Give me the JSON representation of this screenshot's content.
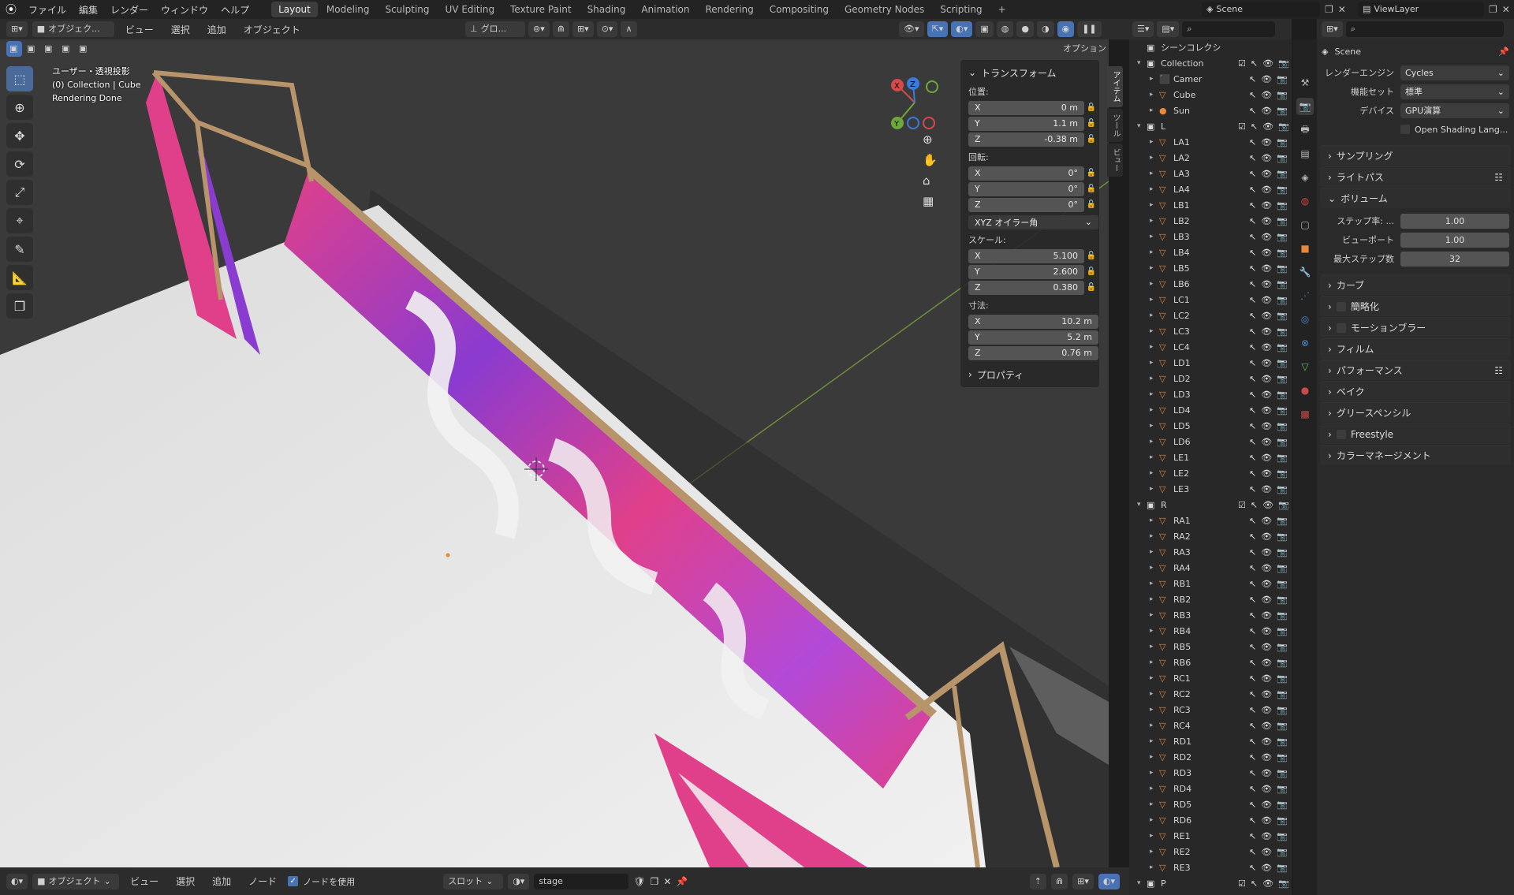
{
  "topbar": {
    "menus": [
      "ファイル",
      "編集",
      "レンダー",
      "ウィンドウ",
      "ヘルプ"
    ],
    "workspaces": [
      "Layout",
      "Modeling",
      "Sculpting",
      "UV Editing",
      "Texture Paint",
      "Shading",
      "Animation",
      "Rendering",
      "Compositing",
      "Geometry Nodes",
      "Scripting"
    ],
    "active_workspace": "Layout",
    "scene": "Scene",
    "viewlayer": "ViewLayer"
  },
  "viewport_header": {
    "mode": "オブジェク...",
    "menus": [
      "ビュー",
      "選択",
      "追加",
      "オブジェクト"
    ],
    "transform_orientation": "グロ...",
    "options": "オプション"
  },
  "overlay": {
    "line1": "ユーザー・透視投影",
    "line2": "(0) Collection | Cube",
    "line3": "Rendering Done"
  },
  "npanel": {
    "title": "トランスフォーム",
    "location_label": "位置:",
    "location": [
      {
        "axis": "X",
        "value": "0 m"
      },
      {
        "axis": "Y",
        "value": "1.1 m"
      },
      {
        "axis": "Z",
        "value": "-0.38 m"
      }
    ],
    "rotation_label": "回転:",
    "rotation": [
      {
        "axis": "X",
        "value": "0°"
      },
      {
        "axis": "Y",
        "value": "0°"
      },
      {
        "axis": "Z",
        "value": "0°"
      }
    ],
    "rotation_mode": "XYZ オイラー角",
    "scale_label": "スケール:",
    "scale": [
      {
        "axis": "X",
        "value": "5.100"
      },
      {
        "axis": "Y",
        "value": "2.600"
      },
      {
        "axis": "Z",
        "value": "0.380"
      }
    ],
    "dimensions_label": "寸法:",
    "dimensions": [
      {
        "axis": "X",
        "value": "10.2 m"
      },
      {
        "axis": "Y",
        "value": "5.2 m"
      },
      {
        "axis": "Z",
        "value": "0.76 m"
      }
    ],
    "properties": "プロパティ",
    "side_tabs": [
      "アイテム",
      "ツール",
      "ビュー"
    ]
  },
  "outliner": {
    "title": "シーンコレクシ",
    "rows": [
      {
        "name": "Collection",
        "level": 0,
        "type": "collection"
      },
      {
        "name": "Camer",
        "level": 1,
        "type": "camera"
      },
      {
        "name": "Cube",
        "level": 1,
        "type": "mesh"
      },
      {
        "name": "Sun",
        "level": 1,
        "type": "light"
      },
      {
        "name": "L",
        "level": 0,
        "type": "collection"
      },
      {
        "name": "LA1",
        "level": 1,
        "type": "mesh"
      },
      {
        "name": "LA2",
        "level": 1,
        "type": "mesh"
      },
      {
        "name": "LA3",
        "level": 1,
        "type": "mesh"
      },
      {
        "name": "LA4",
        "level": 1,
        "type": "mesh"
      },
      {
        "name": "LB1",
        "level": 1,
        "type": "mesh"
      },
      {
        "name": "LB2",
        "level": 1,
        "type": "mesh"
      },
      {
        "name": "LB3",
        "level": 1,
        "type": "mesh"
      },
      {
        "name": "LB4",
        "level": 1,
        "type": "mesh"
      },
      {
        "name": "LB5",
        "level": 1,
        "type": "mesh"
      },
      {
        "name": "LB6",
        "level": 1,
        "type": "mesh"
      },
      {
        "name": "LC1",
        "level": 1,
        "type": "mesh"
      },
      {
        "name": "LC2",
        "level": 1,
        "type": "mesh"
      },
      {
        "name": "LC3",
        "level": 1,
        "type": "mesh"
      },
      {
        "name": "LC4",
        "level": 1,
        "type": "mesh"
      },
      {
        "name": "LD1",
        "level": 1,
        "type": "mesh"
      },
      {
        "name": "LD2",
        "level": 1,
        "type": "mesh"
      },
      {
        "name": "LD3",
        "level": 1,
        "type": "mesh"
      },
      {
        "name": "LD4",
        "level": 1,
        "type": "mesh"
      },
      {
        "name": "LD5",
        "level": 1,
        "type": "mesh"
      },
      {
        "name": "LD6",
        "level": 1,
        "type": "mesh"
      },
      {
        "name": "LE1",
        "level": 1,
        "type": "mesh"
      },
      {
        "name": "LE2",
        "level": 1,
        "type": "mesh"
      },
      {
        "name": "LE3",
        "level": 1,
        "type": "mesh"
      },
      {
        "name": "R",
        "level": 0,
        "type": "collection"
      },
      {
        "name": "RA1",
        "level": 1,
        "type": "mesh"
      },
      {
        "name": "RA2",
        "level": 1,
        "type": "mesh"
      },
      {
        "name": "RA3",
        "level": 1,
        "type": "mesh"
      },
      {
        "name": "RA4",
        "level": 1,
        "type": "mesh"
      },
      {
        "name": "RB1",
        "level": 1,
        "type": "mesh"
      },
      {
        "name": "RB2",
        "level": 1,
        "type": "mesh"
      },
      {
        "name": "RB3",
        "level": 1,
        "type": "mesh"
      },
      {
        "name": "RB4",
        "level": 1,
        "type": "mesh"
      },
      {
        "name": "RB5",
        "level": 1,
        "type": "mesh"
      },
      {
        "name": "RB6",
        "level": 1,
        "type": "mesh"
      },
      {
        "name": "RC1",
        "level": 1,
        "type": "mesh"
      },
      {
        "name": "RC2",
        "level": 1,
        "type": "mesh"
      },
      {
        "name": "RC3",
        "level": 1,
        "type": "mesh"
      },
      {
        "name": "RC4",
        "level": 1,
        "type": "mesh"
      },
      {
        "name": "RD1",
        "level": 1,
        "type": "mesh"
      },
      {
        "name": "RD2",
        "level": 1,
        "type": "mesh"
      },
      {
        "name": "RD3",
        "level": 1,
        "type": "mesh"
      },
      {
        "name": "RD4",
        "level": 1,
        "type": "mesh"
      },
      {
        "name": "RD5",
        "level": 1,
        "type": "mesh"
      },
      {
        "name": "RD6",
        "level": 1,
        "type": "mesh"
      },
      {
        "name": "RE1",
        "level": 1,
        "type": "mesh"
      },
      {
        "name": "RE2",
        "level": 1,
        "type": "mesh"
      },
      {
        "name": "RE3",
        "level": 1,
        "type": "mesh"
      },
      {
        "name": "P",
        "level": 0,
        "type": "collection"
      }
    ]
  },
  "properties": {
    "scene_name": "Scene",
    "render_engine_label": "レンダーエンジン",
    "render_engine": "Cycles",
    "feature_set_label": "機能セット",
    "feature_set": "標準",
    "device_label": "デバイス",
    "device": "GPU演算",
    "osl_label": "Open Shading Lang...",
    "sections": {
      "sampling": "サンプリング",
      "light_paths": "ライトパス",
      "volume": "ボリューム",
      "curves": "カーブ",
      "simplify": "簡略化",
      "motion_blur": "モーションブラー",
      "film": "フィルム",
      "performance": "パフォーマンス",
      "bake": "ベイク",
      "grease_pencil": "グリースペンシル",
      "freestyle": "Freestyle",
      "color_management": "カラーマネージメント"
    },
    "volume": {
      "step_rate_label": "ステップ率: ...",
      "step_rate": "1.00",
      "viewport_label": "ビューポート",
      "viewport": "1.00",
      "max_steps_label": "最大ステップ数",
      "max_steps": "32"
    }
  },
  "bottom": {
    "mode": "オブジェクト",
    "menus": [
      "ビュー",
      "選択",
      "追加",
      "ノード"
    ],
    "use_nodes": "ノードを使用",
    "slot": "スロット",
    "material": "stage"
  },
  "colors": {
    "accent": "#4772b3",
    "wall_pink": "#e0408a",
    "wall_purple": "#8a3bd0",
    "floor": "#e4e4e4"
  }
}
